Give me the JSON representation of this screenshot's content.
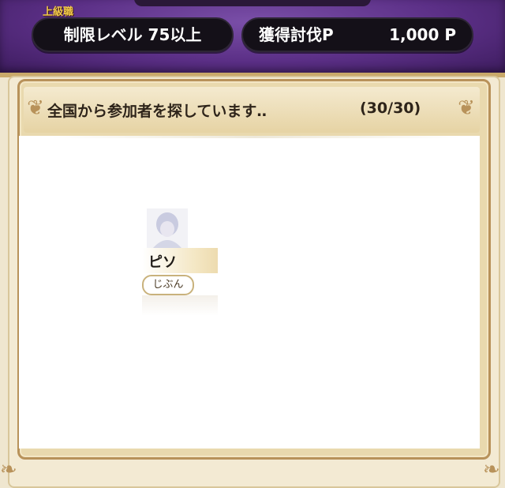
{
  "header": {
    "rank_label": "上級職",
    "level_limit": "制限レベル 75以上",
    "points_label": "獲得討伐P",
    "points_value": "1,000 P"
  },
  "panel": {
    "title": "全国から参加者を探しています‥",
    "count": "(30/30)"
  },
  "player": {
    "name": "ピソ",
    "tag": "じぶん",
    "avatar_icon": "character-portrait-icon"
  },
  "colors": {
    "header_purple": "#5b2f86",
    "gold_accent": "#f2c94a",
    "frame_gold": "#b8925a",
    "pill_bg": "#141018"
  }
}
